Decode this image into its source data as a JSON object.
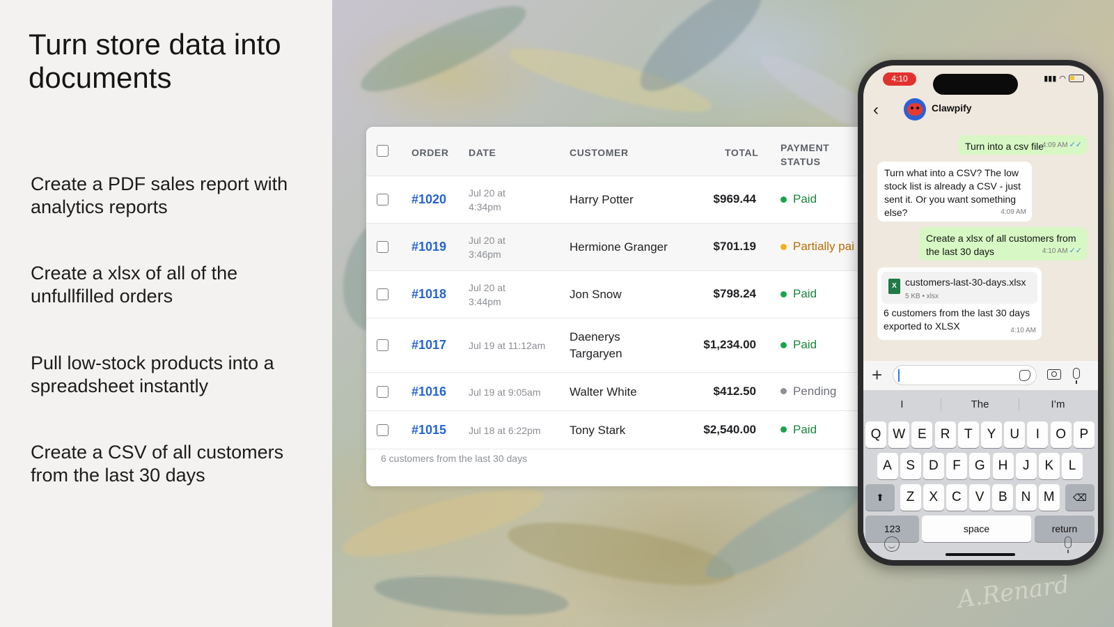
{
  "headline": "Turn store data into documents",
  "features": [
    "Create a PDF sales report with analytics reports",
    "Create a xlsx of all of the unfullfilled orders",
    "Pull low-stock products into a spreadsheet instantly",
    "Create a CSV of all customers from the last 30 days"
  ],
  "table": {
    "headers": {
      "order": "ORDER",
      "date": "DATE",
      "customer": "CUSTOMER",
      "total": "TOTAL",
      "payment_status": "PAYMENT STATUS"
    },
    "rows": [
      {
        "order": "#1020",
        "date": "Jul 20 at 4:34pm",
        "customer": "Harry Potter",
        "total": "$969.44",
        "status": "Paid"
      },
      {
        "order": "#1019",
        "date": "Jul 20 at 3:46pm",
        "customer": "Hermione Granger",
        "total": "$701.19",
        "status": "Partially pai"
      },
      {
        "order": "#1018",
        "date": "Jul 20 at 3:44pm",
        "customer": "Jon Snow",
        "total": "$798.24",
        "status": "Paid"
      },
      {
        "order": "#1017",
        "date": "Jul 19 at 11:12am",
        "customer": "Daenerys Targaryen",
        "total": "$1,234.00",
        "status": "Paid"
      },
      {
        "order": "#1016",
        "date": "Jul 19 at 9:05am",
        "customer": "Walter White",
        "total": "$412.50",
        "status": "Pending"
      },
      {
        "order": "#1015",
        "date": "Jul 18 at 6:22pm",
        "customer": "Tony Stark",
        "total": "$2,540.00",
        "status": "Paid"
      }
    ],
    "footer": "6 customers from the last 30 days",
    "status_colors": {
      "paid": "#1aa34a",
      "partial": "#f2b21b",
      "pending": "#8d9096",
      "paid_text": "#17853c",
      "partial_text": "#b86e00",
      "pending_text": "#6d7076"
    }
  },
  "phone": {
    "time": "4:10",
    "contact_name": "Clawpify",
    "messages": [
      {
        "dir": "out",
        "text": "Turn into a csv file",
        "time": "4:09 AM"
      },
      {
        "dir": "in",
        "text": "Turn what into a CSV? The low stock list is already a CSV - just sent it. Or you want something else?",
        "time": "4:09 AM"
      },
      {
        "dir": "out",
        "text": "Create a xlsx of all customers from the last 30 days",
        "time": "4:10 AM"
      },
      {
        "dir": "in",
        "file_name": "customers-last-30-days.xlsx",
        "file_meta": "5 KB • xlsx",
        "file_icon_label": "X",
        "text": "6 customers from the last 30 days exported to XLSX",
        "time": "4:10 AM"
      }
    ],
    "ticks": "✓✓",
    "input_value": "",
    "suggestions": [
      "I",
      "The",
      "I’m"
    ],
    "keyboard": {
      "row1": [
        "Q",
        "W",
        "E",
        "R",
        "T",
        "Y",
        "U",
        "I",
        "O",
        "P"
      ],
      "row2": [
        "A",
        "S",
        "D",
        "F",
        "G",
        "H",
        "J",
        "K",
        "L"
      ],
      "row3": [
        "Z",
        "X",
        "C",
        "V",
        "B",
        "N",
        "M"
      ],
      "shift": "⬆",
      "backspace": "⌫",
      "numbers": "123",
      "space": "space",
      "return": "return"
    },
    "back_glyph": "‹",
    "plus_glyph": "+"
  },
  "signature": "A.Renard",
  "icons": [
    "checkbox-icon",
    "back-icon",
    "avatar-icon",
    "xlsx-file-icon",
    "plus-icon",
    "sticker-icon",
    "camera-icon",
    "mic-icon",
    "emoji-icon",
    "shift-icon",
    "backspace-icon"
  ]
}
